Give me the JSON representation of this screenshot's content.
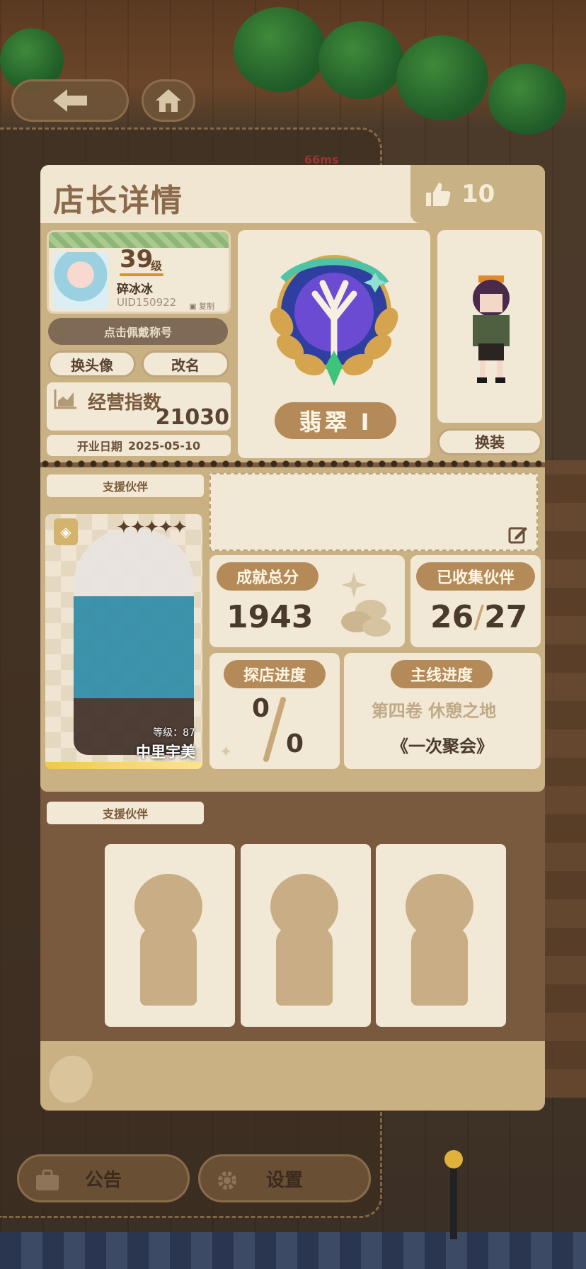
{
  "header": {
    "title": "店长详情",
    "likes": "10"
  },
  "network": {
    "ping": "66ms"
  },
  "profile": {
    "level": "39",
    "level_unit": "级",
    "username": "碎冰冰",
    "uid": "UID150922",
    "copy_label": "复制",
    "title_button": "点击佩戴称号",
    "change_avatar": "换头像",
    "rename": "改名",
    "business_index_label": "经营指数",
    "business_index_value": "21030",
    "open_date_label": "开业日期",
    "open_date_value": "2025-05-10"
  },
  "rank": {
    "name": "翡翠 I"
  },
  "outfit": {
    "button": "换装"
  },
  "support": {
    "section_label": "支援伙伴",
    "partner_level": "等级：87",
    "partner_name": "中里宇美",
    "stars": "✦✦✦✦✦"
  },
  "stats": {
    "achievement_label": "成就总分",
    "achievement_value": "1943",
    "collected_label": "已收集伙伴",
    "collected_value": "26",
    "collected_total": "27",
    "explore_label": "探店进度",
    "explore_value": "0",
    "explore_total": "0",
    "story_label": "主线进度",
    "story_volume": "第四卷 休憩之地",
    "story_chapter": "《一次聚会》"
  },
  "support2": {
    "section_label": "支援伙伴"
  },
  "bottom": {
    "notice": "公告",
    "settings": "设置"
  },
  "colors": {
    "accent": "#b48a58",
    "panel": "#f2e8d6",
    "frame": "#c9b183"
  }
}
